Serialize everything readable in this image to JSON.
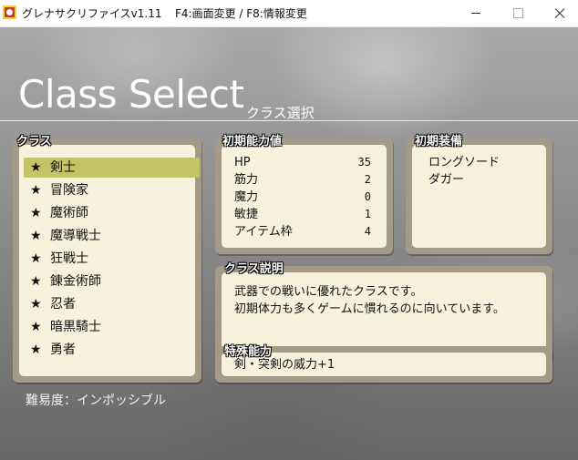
{
  "window": {
    "title": "グレナサクリファイスv1.11",
    "hint": "F4:画面変更 / F8:情報変更"
  },
  "screen": {
    "title": "Class Select",
    "subtitle": "クラス選択",
    "difficulty": "難易度：インポッシブル"
  },
  "class_panel": {
    "label": "クラス",
    "selected_index": 0,
    "items": [
      {
        "star": "★",
        "name": "剣士"
      },
      {
        "star": "★",
        "name": "冒険家"
      },
      {
        "star": "★",
        "name": "魔術師"
      },
      {
        "star": "★",
        "name": "魔導戦士"
      },
      {
        "star": "★",
        "name": "狂戦士"
      },
      {
        "star": "★",
        "name": "錬金術師"
      },
      {
        "star": "★",
        "name": "忍者"
      },
      {
        "star": "★",
        "name": "暗黒騎士"
      },
      {
        "star": "★",
        "name": "勇者"
      }
    ]
  },
  "stats_panel": {
    "label": "初期能力値",
    "stats": [
      {
        "name": "HP",
        "value": "35"
      },
      {
        "name": "筋力",
        "value": "2"
      },
      {
        "name": "魔力",
        "value": "0"
      },
      {
        "name": "敏捷",
        "value": "1"
      },
      {
        "name": "アイテム枠",
        "value": "4"
      }
    ]
  },
  "equip_panel": {
    "label": "初期装備",
    "items": [
      "ロングソード",
      "ダガー"
    ]
  },
  "desc_panel": {
    "label": "クラス説明",
    "lines": [
      "武器での戦いに優れたクラスです。",
      "初期体力も多くゲームに慣れるのに向いています。"
    ]
  },
  "skill_panel": {
    "label": "特殊能力",
    "text": "剣・突剣の威力+1"
  },
  "colors": {
    "panel_frame": "#a59988",
    "panel_fill": "#f6f2dc",
    "selection": "#c4c466"
  }
}
